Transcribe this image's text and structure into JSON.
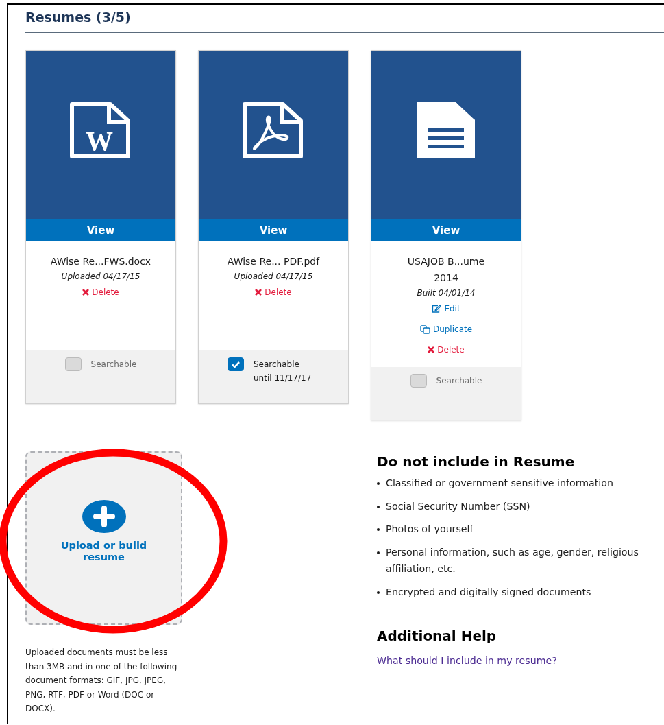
{
  "heading": "Resumes (3/5)",
  "cards": [
    {
      "kind": "word",
      "icon_text": "W",
      "view_label": "View",
      "name": "AWise Re...FWS.docx",
      "date": "Uploaded 04/17/15",
      "actions": [
        {
          "kind": "delete",
          "label": "Delete"
        }
      ],
      "searchable": {
        "checked": false,
        "label": "Searchable"
      }
    },
    {
      "kind": "pdf",
      "view_label": "View",
      "name": "AWise Re... PDF.pdf",
      "date": "Uploaded 04/17/15",
      "actions": [
        {
          "kind": "delete",
          "label": "Delete"
        }
      ],
      "searchable": {
        "checked": true,
        "label": "Searchable until 11/17/17"
      }
    },
    {
      "kind": "text",
      "view_label": "View",
      "name": "USAJOB B...ume 2014",
      "date": "Built 04/01/14",
      "actions": [
        {
          "kind": "edit",
          "label": "Edit"
        },
        {
          "kind": "duplicate",
          "label": "Duplicate"
        },
        {
          "kind": "delete",
          "label": "Delete"
        }
      ],
      "searchable": {
        "checked": false,
        "label": "Searchable"
      }
    }
  ],
  "upload": {
    "label": "Upload or build resume",
    "note": "Uploaded documents must be less than 3MB and in one of the following document formats: GIF, JPG, JPEG, PNG, RTF, PDF or Word (DOC or DOCX)."
  },
  "exclusions": {
    "title": "Do not include in Resume",
    "items": [
      "Classified or government sensitive information",
      "Social Security Number (SSN)",
      "Photos of yourself",
      "Personal information, such as age, gender, religious affiliation, etc.",
      "Encrypted and digitally signed documents"
    ]
  },
  "help": {
    "title": "Additional Help",
    "link": "What should I include in my resume?"
  }
}
